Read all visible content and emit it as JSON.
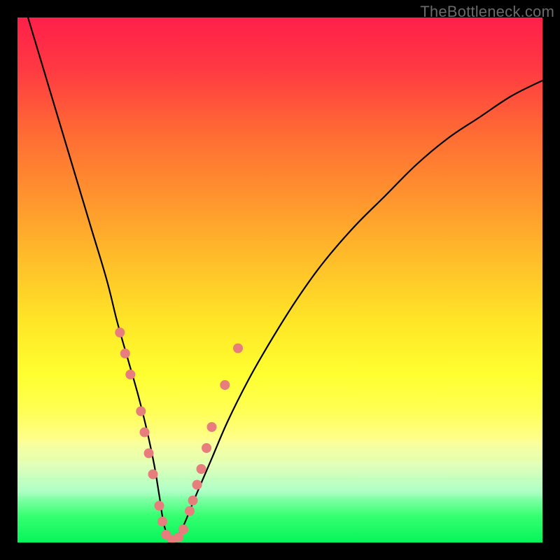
{
  "watermark": "TheBottleneck.com",
  "chart_data": {
    "type": "line",
    "title": "",
    "xlabel": "",
    "ylabel": "",
    "xlim": [
      0,
      100
    ],
    "ylim": [
      0,
      100
    ],
    "legend": false,
    "grid": false,
    "background_gradient": [
      "#ff1f4a",
      "#ffff30",
      "#05f55a"
    ],
    "series": [
      {
        "name": "bottleneck-curve",
        "x": [
          2,
          5,
          8,
          11,
          14,
          17,
          19,
          21,
          23,
          24.5,
          26,
          27,
          28,
          29.5,
          31.5,
          34,
          37,
          40,
          44,
          48,
          53,
          58,
          64,
          70,
          76,
          82,
          88,
          94,
          100
        ],
        "y": [
          100,
          90,
          80,
          70,
          60,
          50,
          42,
          35,
          28,
          22,
          15,
          9,
          3,
          0,
          3,
          9,
          16,
          23,
          31,
          38,
          46,
          53,
          60,
          66,
          72,
          77,
          81,
          85,
          88
        ]
      }
    ],
    "markers": {
      "name": "highlighted-points",
      "comment": "pink dots/pills near the valley region",
      "points": [
        {
          "x": 19.5,
          "y": 40,
          "r": 7
        },
        {
          "x": 20.5,
          "y": 36,
          "r": 7
        },
        {
          "x": 21.5,
          "y": 32,
          "r": 7
        },
        {
          "x": 23.5,
          "y": 25,
          "r": 7
        },
        {
          "x": 24.2,
          "y": 21,
          "r": 7
        },
        {
          "x": 25.0,
          "y": 17,
          "r": 7
        },
        {
          "x": 25.8,
          "y": 13,
          "r": 7
        },
        {
          "x": 27.0,
          "y": 7,
          "r": 7
        },
        {
          "x": 27.6,
          "y": 4,
          "r": 7
        },
        {
          "x": 28.3,
          "y": 1.5,
          "r": 7
        },
        {
          "x": 29.5,
          "y": 0.5,
          "r": 7
        },
        {
          "x": 30.7,
          "y": 1.0,
          "r": 7
        },
        {
          "x": 31.6,
          "y": 2.5,
          "r": 7
        },
        {
          "x": 32.8,
          "y": 6,
          "r": 7
        },
        {
          "x": 33.4,
          "y": 8,
          "r": 7
        },
        {
          "x": 34.2,
          "y": 11,
          "r": 7
        },
        {
          "x": 35.0,
          "y": 14,
          "r": 7
        },
        {
          "x": 36.0,
          "y": 18,
          "r": 7
        },
        {
          "x": 37.0,
          "y": 22,
          "r": 7
        },
        {
          "x": 39.5,
          "y": 30,
          "r": 7
        },
        {
          "x": 42.0,
          "y": 37,
          "r": 7
        }
      ]
    },
    "bands": [
      {
        "y": 80.5,
        "h": 3.2
      },
      {
        "y": 84.5,
        "h": 3.2
      },
      {
        "y": 88.0,
        "h": 3.2
      }
    ]
  }
}
